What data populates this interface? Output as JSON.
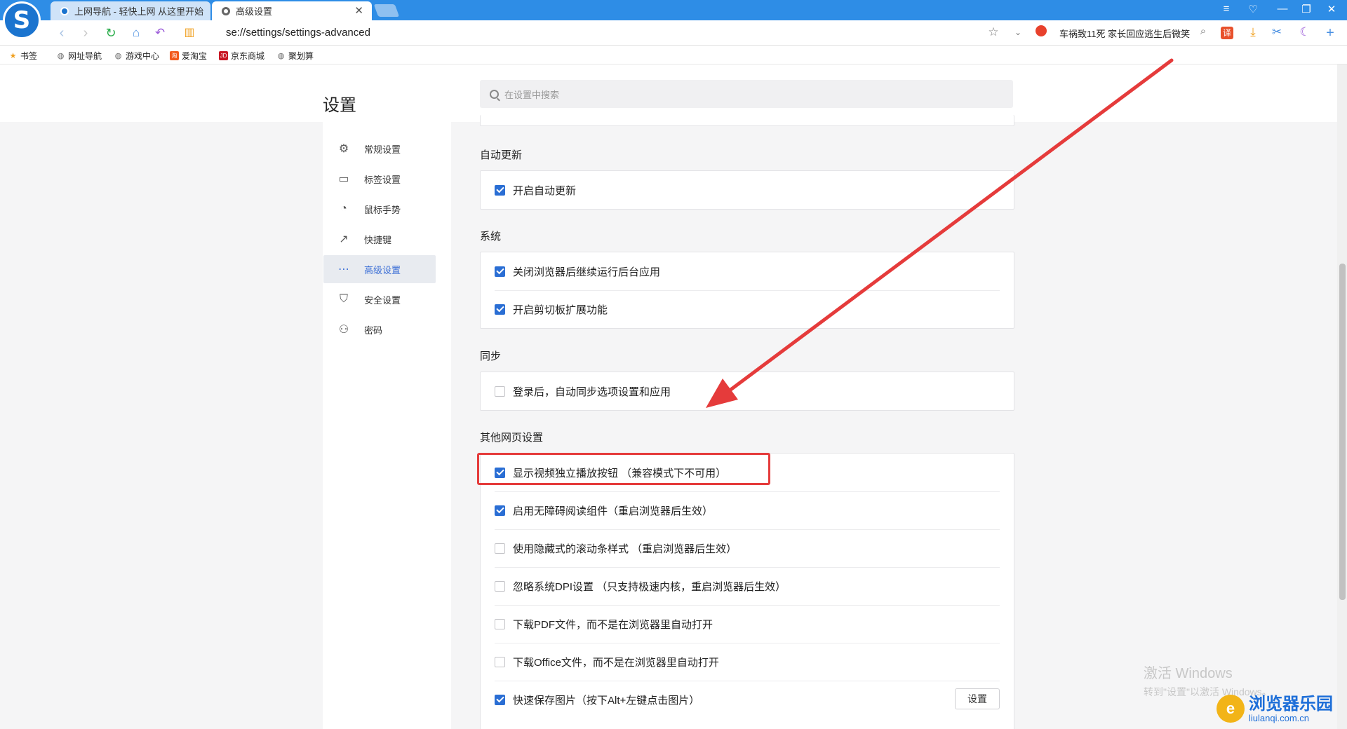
{
  "tabs": [
    {
      "title": "上网导航 - 轻快上网 从这里开始",
      "active": false
    },
    {
      "title": "高级设置",
      "active": true
    }
  ],
  "address": {
    "url": "se://settings/settings-advanced",
    "news": "车祸致11死 家长回应逃生后微笑"
  },
  "bookmarks": [
    "书签",
    "网址导航",
    "游戏中心",
    "爱淘宝",
    "京东商城",
    "聚划算"
  ],
  "settings": {
    "title": "设置",
    "search_placeholder": "在设置中搜索",
    "nav": [
      {
        "label": "常规设置",
        "icon": "gear-icon",
        "active": false
      },
      {
        "label": "标签设置",
        "icon": "tab-icon",
        "active": false
      },
      {
        "label": "鼠标手势",
        "icon": "mouse-icon",
        "active": false
      },
      {
        "label": "快捷键",
        "icon": "shortcut-icon",
        "active": false
      },
      {
        "label": "高级设置",
        "icon": "more-icon",
        "active": true
      },
      {
        "label": "安全设置",
        "icon": "shield-icon",
        "active": false
      },
      {
        "label": "密码",
        "icon": "user-icon",
        "active": false
      }
    ],
    "sections": [
      {
        "title": "自动更新",
        "items": [
          {
            "label": "开启自动更新",
            "checked": true
          }
        ]
      },
      {
        "title": "系统",
        "items": [
          {
            "label": "关闭浏览器后继续运行后台应用",
            "checked": true
          },
          {
            "label": "开启剪切板扩展功能",
            "checked": true
          }
        ]
      },
      {
        "title": "同步",
        "items": [
          {
            "label": "登录后，自动同步选项设置和应用",
            "checked": false
          }
        ]
      },
      {
        "title": "其他网页设置",
        "items": [
          {
            "label": "显示视频独立播放按钮 （兼容模式下不可用）",
            "checked": true
          },
          {
            "label": "启用无障碍阅读组件（重启浏览器后生效）",
            "checked": true
          },
          {
            "label": "使用隐藏式的滚动条样式 （重启浏览器后生效）",
            "checked": false
          },
          {
            "label": "忽略系统DPI设置 （只支持极速内核，重启浏览器后生效）",
            "checked": false
          },
          {
            "label": "下载PDF文件，而不是在浏览器里自动打开",
            "checked": false
          },
          {
            "label": "下载Office文件，而不是在浏览器里自动打开",
            "checked": false
          },
          {
            "label": "快速保存图片（按下Alt+左键点击图片）",
            "checked": true
          }
        ]
      }
    ],
    "set_button": "设置"
  },
  "overlay": {
    "activate_line1": "激活 Windows",
    "activate_line2": "转到\"设置\"以激活 Windows。",
    "watermark_title": "浏览器乐园",
    "watermark_url": "liulanqi.com.cn"
  }
}
